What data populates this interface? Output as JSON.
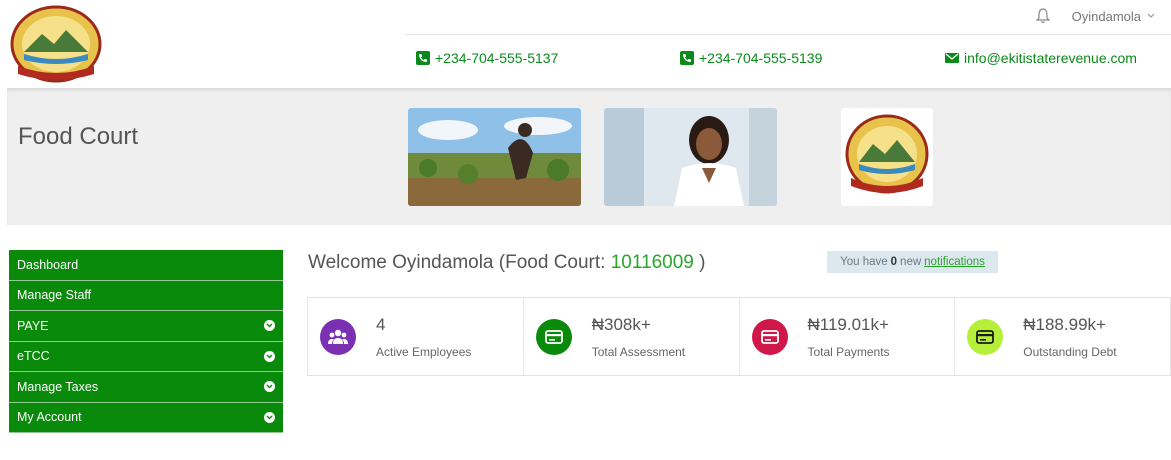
{
  "header": {
    "user_name": "Oyindamola",
    "contacts": [
      {
        "icon": "phone-icon",
        "text": "+234-704-555-5137"
      },
      {
        "icon": "phone-icon",
        "text": "+234-704-555-5139"
      },
      {
        "icon": "envelope-icon",
        "text": "info@ekitistaterevenue.com"
      }
    ]
  },
  "banner": {
    "title": "Food Court"
  },
  "sidebar": {
    "items": [
      {
        "label": "Dashboard",
        "has_dropdown": false
      },
      {
        "label": "Manage Staff",
        "has_dropdown": false
      },
      {
        "label": "PAYE",
        "has_dropdown": true
      },
      {
        "label": "eTCC",
        "has_dropdown": true
      },
      {
        "label": "Manage Taxes",
        "has_dropdown": true
      },
      {
        "label": "My Account",
        "has_dropdown": true
      }
    ]
  },
  "welcome": {
    "prefix": "Welcome Oyindamola (Food Court: ",
    "code": "10116009",
    "suffix": " )"
  },
  "notice": {
    "prefix": "You have",
    "count": "0",
    "middle": "new",
    "link": "notifications"
  },
  "stats": [
    {
      "value": "4",
      "label": "Active Employees",
      "icon": "users-icon",
      "color": "#7b2fb3"
    },
    {
      "value": "₦308k+",
      "label": "Total Assessment",
      "icon": "card-icon",
      "color": "#0a8a0a"
    },
    {
      "value": "₦119.01k+",
      "label": "Total Payments",
      "icon": "card-icon",
      "color": "#d0174a"
    },
    {
      "value": "₦188.99k+",
      "label": "Outstanding Debt",
      "icon": "card-icon",
      "color": "#b5ef3a"
    }
  ],
  "colors": {
    "accent": "#0a8a0a",
    "link": "#2aa52a",
    "banner_bg": "#efefef"
  }
}
